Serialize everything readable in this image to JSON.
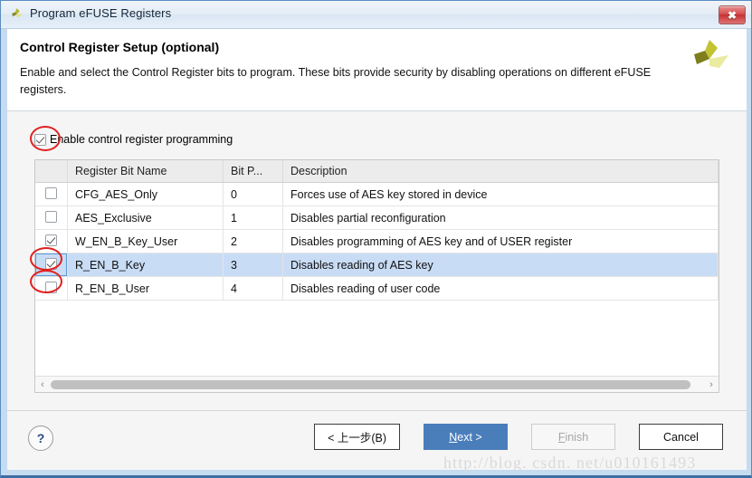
{
  "window": {
    "title": "Program eFUSE Registers",
    "icon": "xilinx-logo-icon",
    "close_label": "✖"
  },
  "header": {
    "title": "Control Register Setup (optional)",
    "description": "Enable and select the Control Register bits to program. These bits provide security by disabling operations on different eFUSE registers.",
    "logo": "xilinx-logo-icon"
  },
  "enable": {
    "label": "Enable control register programming",
    "checked": true
  },
  "table": {
    "columns": [
      "",
      "Register Bit Name",
      "Bit P...",
      "Description"
    ],
    "rows": [
      {
        "checked": false,
        "name": "CFG_AES_Only",
        "bit": "0",
        "description": "Forces use of AES key stored in device",
        "selected": false
      },
      {
        "checked": false,
        "name": "AES_Exclusive",
        "bit": "1",
        "description": "Disables partial reconfiguration",
        "selected": false
      },
      {
        "checked": true,
        "name": "W_EN_B_Key_User",
        "bit": "2",
        "description": "Disables programming of AES key and of USER register",
        "selected": false
      },
      {
        "checked": true,
        "name": "R_EN_B_Key",
        "bit": "3",
        "description": "Disables reading of AES key",
        "selected": true
      },
      {
        "checked": false,
        "name": "R_EN_B_User",
        "bit": "4",
        "description": "Disables reading of user code",
        "selected": false
      }
    ]
  },
  "scrollbar": {
    "left_arrow": "‹",
    "right_arrow": "›"
  },
  "footer": {
    "help_label": "?",
    "buttons": {
      "back": "< 上一步(B)",
      "next_prefix": "N",
      "next_suffix": "ext >",
      "finish_prefix": "F",
      "finish_suffix": "inish",
      "cancel": "Cancel"
    }
  },
  "watermark": "http://blog. csdn. net/u010161493",
  "colors": {
    "accent_blue": "#4a7ebb",
    "selection_blue": "#c9dcf5",
    "annotation_red": "#e02020",
    "close_red": "#c53232",
    "logo_olive": "#9a9a29"
  }
}
